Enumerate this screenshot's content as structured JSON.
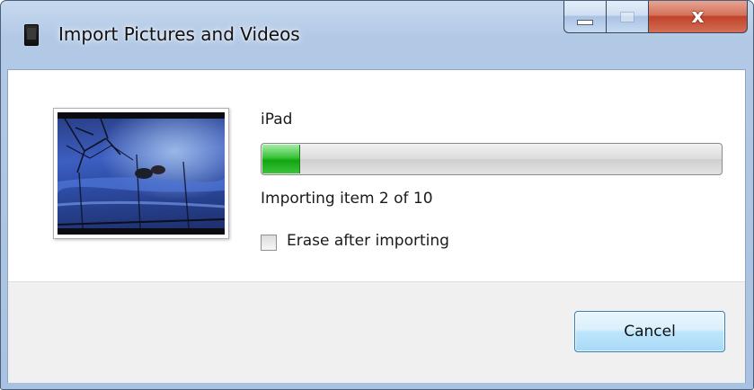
{
  "window": {
    "title": "Import Pictures and Videos",
    "icon": "ipad-device-icon"
  },
  "caption_buttons": {
    "minimize_icon": "minimize-icon",
    "maximize_icon": "maximize-icon",
    "close_glyph": "x"
  },
  "import": {
    "device_name": "iPad",
    "progress_fraction": 0.08,
    "status_text": "Importing item 2 of 10",
    "erase_label": "Erase after importing",
    "erase_checked": false
  },
  "buttons": {
    "cancel_label": "Cancel"
  },
  "colors": {
    "progress_green": "#2fbf2f",
    "close_red": "#c7432b",
    "titlebar_blue": "#b2c9e6"
  }
}
